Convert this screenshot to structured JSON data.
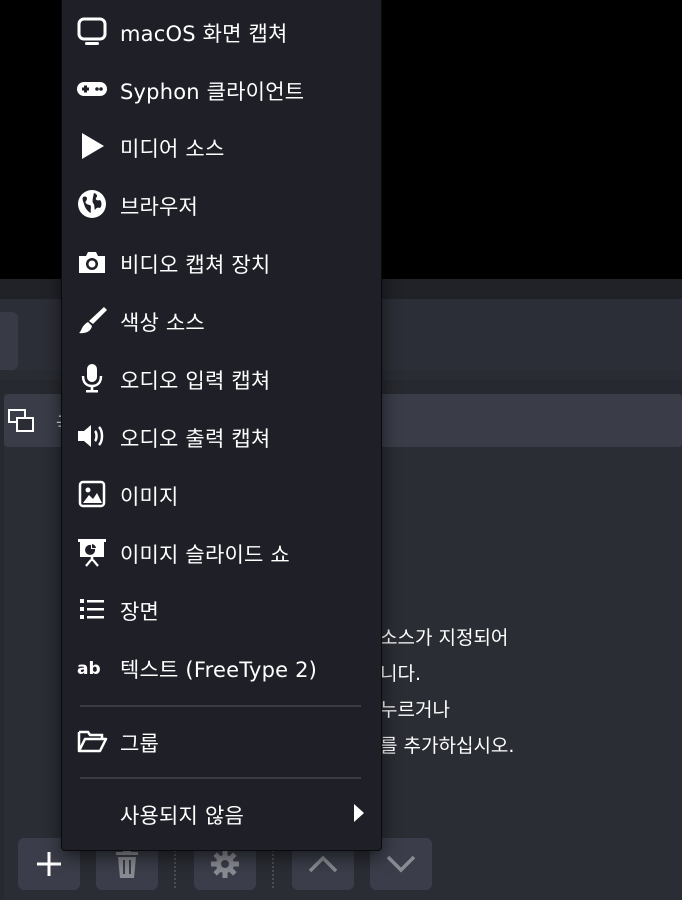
{
  "menu": {
    "items": [
      {
        "label": "macOS 화면 캡쳐",
        "icon": "monitor-icon"
      },
      {
        "label": "Syphon 클라이언트",
        "icon": "gamepad-icon"
      },
      {
        "label": "미디어 소스",
        "icon": "play-icon"
      },
      {
        "label": "브라우저",
        "icon": "globe-icon"
      },
      {
        "label": "비디오 캡쳐 장치",
        "icon": "camera-icon"
      },
      {
        "label": "색상 소스",
        "icon": "paint-brush-icon"
      },
      {
        "label": "오디오 입력 캡쳐",
        "icon": "microphone-icon"
      },
      {
        "label": "오디오 출력 캡쳐",
        "icon": "speaker-icon"
      },
      {
        "label": "이미지",
        "icon": "image-icon"
      },
      {
        "label": "이미지 슬라이드 쇼",
        "icon": "slideshow-icon"
      },
      {
        "label": "장면",
        "icon": "list-icon"
      },
      {
        "label": "텍스트 (FreeType 2)",
        "icon": "text-ab-icon"
      }
    ],
    "group": {
      "label": "그룹",
      "icon": "folder-open-icon"
    },
    "deprecated": {
      "label": "사용되지 않음",
      "icon": "chevron-right-icon"
    }
  },
  "sources": {
    "row_label_peek": "극",
    "help_lines": [
      " 소스가 지정되어",
      "니다.",
      "누르거나",
      "를 추가하십시오."
    ]
  },
  "toolbar": {
    "buttons": [
      "plus-icon",
      "trash-icon",
      "gear-icon",
      "chevron-up-icon",
      "chevron-down-icon"
    ]
  },
  "colors": {
    "menu_bg": "#1f2027",
    "panel_bg": "#2b2d35",
    "row_bg": "#3a3d48",
    "button_bg": "#3b3e4a"
  }
}
